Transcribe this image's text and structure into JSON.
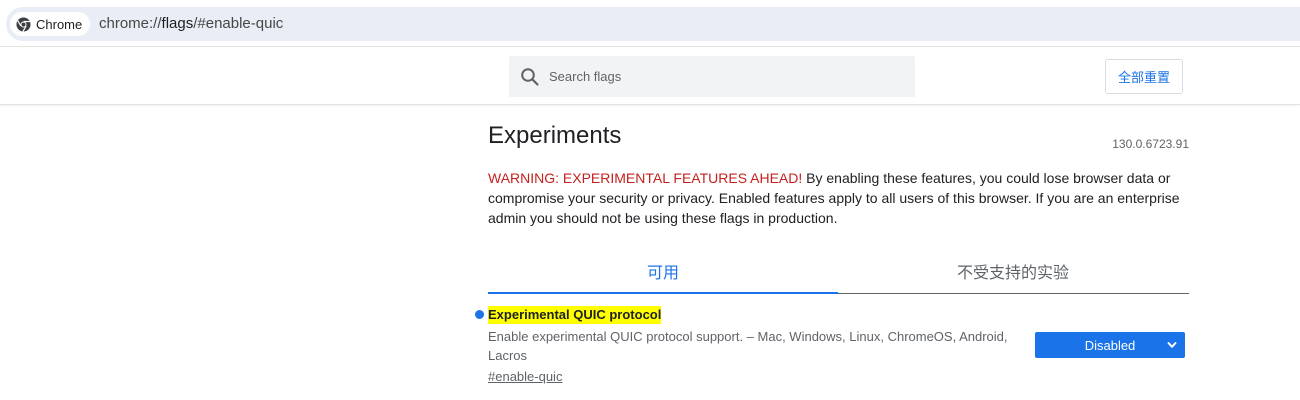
{
  "omnibox": {
    "chip_label": "Chrome",
    "url_prefix": "chrome://",
    "url_host": "flags",
    "url_rest": "/#enable-quic"
  },
  "toolbar": {
    "search_placeholder": "Search flags",
    "reset_label": "全部重置"
  },
  "page": {
    "title": "Experiments",
    "version": "130.0.6723.91",
    "warning_red": "WARNING: EXPERIMENTAL FEATURES AHEAD!",
    "warning_text": " By enabling these features, you could lose browser data or compromise your security or privacy. Enabled features apply to all users of this browser. If you are an enterprise admin you should not be using these flags in production."
  },
  "tabs": [
    {
      "label": "可用",
      "active": true
    },
    {
      "label": "不受支持的实验",
      "active": false
    }
  ],
  "experiment": {
    "name": "Experimental QUIC protocol",
    "description": "Enable experimental QUIC protocol support. – Mac, Windows, Linux, ChromeOS, Android, Lacros",
    "link": "#enable-quic",
    "selected_option": "Disabled"
  },
  "colors": {
    "accent": "#1a73e8",
    "warning": "#c5221f",
    "highlight": "#ffff00"
  }
}
